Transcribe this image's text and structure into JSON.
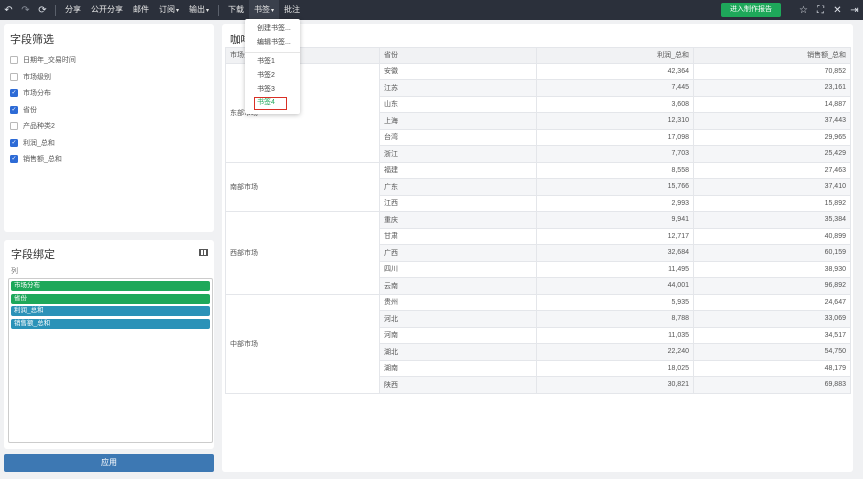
{
  "toolbar": {
    "items": [
      {
        "label": "分享",
        "caret": false
      },
      {
        "label": "公开分享",
        "caret": false
      },
      {
        "label": "邮件",
        "caret": false
      },
      {
        "label": "订阅",
        "caret": true
      },
      {
        "label": "输出",
        "caret": true
      },
      {
        "label": "下载",
        "caret": false
      },
      {
        "label": "书签",
        "caret": true
      },
      {
        "label": "批注",
        "caret": false
      }
    ],
    "enter_button": "进入制作报告",
    "accent_color": "#1ea85a"
  },
  "bookmark_menu": {
    "items": [
      "创建书签...",
      "编辑书签..."
    ],
    "bookmarks": [
      "书签1",
      "书签2",
      "书签3",
      "书签4"
    ],
    "selected": "书签4"
  },
  "filter_panel": {
    "title": "字段筛选",
    "fields": [
      {
        "label": "日期年_交易时间",
        "checked": false
      },
      {
        "label": "市场级别",
        "checked": false
      },
      {
        "label": "市场分布",
        "checked": true
      },
      {
        "label": "省份",
        "checked": true
      },
      {
        "label": "产品种类2",
        "checked": false
      },
      {
        "label": "利润_总和",
        "checked": true
      },
      {
        "label": "销售额_总和",
        "checked": true
      }
    ]
  },
  "bind_panel": {
    "title": "字段绑定",
    "column_label": "列",
    "chips": [
      {
        "label": "市场分布",
        "color": "green"
      },
      {
        "label": "省份",
        "color": "green"
      },
      {
        "label": "利润_总和",
        "color": "blue"
      },
      {
        "label": "销售额_总和",
        "color": "blue"
      }
    ]
  },
  "apply_button": "应用",
  "report": {
    "title": "咖啡销售数据2",
    "headers": [
      "市场分布",
      "省份",
      "利润_总和",
      "销售额_总和"
    ],
    "groups": [
      {
        "region": "东部市场",
        "rows": [
          [
            "安徽",
            "42,364",
            "70,852"
          ],
          [
            "江苏",
            "7,445",
            "23,161"
          ],
          [
            "山东",
            "3,608",
            "14,887"
          ],
          [
            "上海",
            "12,310",
            "37,443"
          ],
          [
            "台湾",
            "17,098",
            "29,965"
          ],
          [
            "浙江",
            "7,703",
            "25,429"
          ]
        ]
      },
      {
        "region": "南部市场",
        "rows": [
          [
            "福建",
            "8,558",
            "27,463"
          ],
          [
            "广东",
            "15,766",
            "37,410"
          ],
          [
            "江西",
            "2,993",
            "15,892"
          ]
        ]
      },
      {
        "region": "西部市场",
        "rows": [
          [
            "重庆",
            "9,941",
            "35,384"
          ],
          [
            "甘肃",
            "12,717",
            "40,899"
          ],
          [
            "广西",
            "32,684",
            "60,159"
          ],
          [
            "四川",
            "11,495",
            "38,930"
          ],
          [
            "云南",
            "44,001",
            "96,892"
          ]
        ]
      },
      {
        "region": "中部市场",
        "rows": [
          [
            "贵州",
            "5,935",
            "24,647"
          ],
          [
            "河北",
            "8,788",
            "33,069"
          ],
          [
            "河南",
            "11,035",
            "34,517"
          ],
          [
            "湖北",
            "22,240",
            "54,750"
          ],
          [
            "湖南",
            "18,025",
            "48,179"
          ],
          [
            "陕西",
            "30,821",
            "69,883"
          ]
        ]
      }
    ]
  }
}
